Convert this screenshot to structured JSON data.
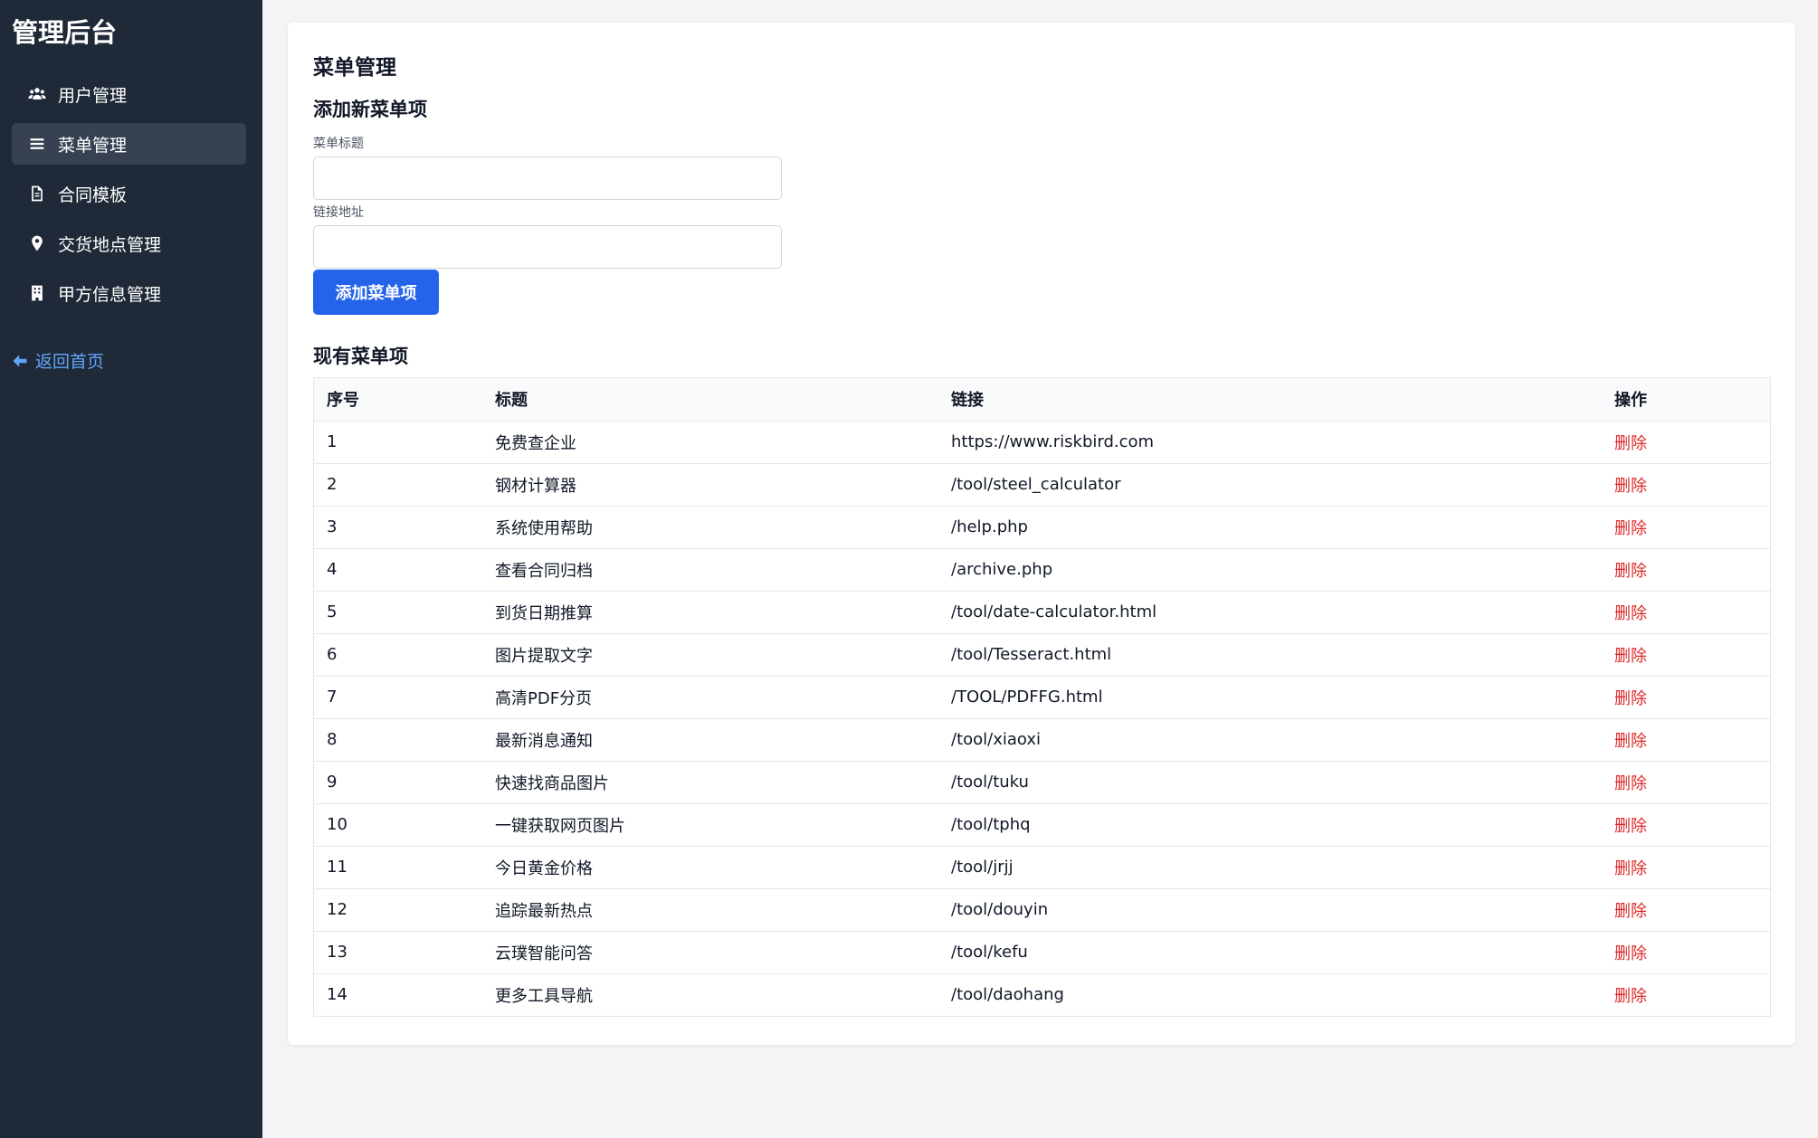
{
  "sidebar": {
    "brand": "管理后台",
    "items": [
      {
        "label": "用户管理",
        "icon": "users-icon"
      },
      {
        "label": "菜单管理",
        "icon": "bars-icon",
        "active": true
      },
      {
        "label": "合同模板",
        "icon": "file-icon"
      },
      {
        "label": "交货地点管理",
        "icon": "map-pin-icon"
      },
      {
        "label": "甲方信息管理",
        "icon": "building-icon"
      }
    ],
    "back": {
      "label": "返回首页",
      "icon": "arrow-left-icon"
    }
  },
  "main": {
    "title": "菜单管理",
    "form": {
      "heading": "添加新菜单项",
      "title_label": "菜单标题",
      "title_value": "",
      "link_label": "链接地址",
      "link_value": "",
      "submit_label": "添加菜单项"
    },
    "list": {
      "heading": "现有菜单项",
      "columns": [
        "序号",
        "标题",
        "链接",
        "操作"
      ],
      "rows": [
        {
          "id": "1",
          "title": "免费查企业",
          "link": "https://www.riskbird.com",
          "action": "删除"
        },
        {
          "id": "2",
          "title": "钢材计算器",
          "link": "/tool/steel_calculator",
          "action": "删除"
        },
        {
          "id": "3",
          "title": "系统使用帮助",
          "link": "/help.php",
          "action": "删除"
        },
        {
          "id": "4",
          "title": "查看合同归档",
          "link": "/archive.php",
          "action": "删除"
        },
        {
          "id": "5",
          "title": "到货日期推算",
          "link": "/tool/date-calculator.html",
          "action": "删除"
        },
        {
          "id": "6",
          "title": "图片提取文字",
          "link": "/tool/Tesseract.html",
          "action": "删除"
        },
        {
          "id": "7",
          "title": "高清PDF分页",
          "link": "/TOOL/PDFFG.html",
          "action": "删除"
        },
        {
          "id": "8",
          "title": "最新消息通知",
          "link": "/tool/xiaoxi",
          "action": "删除"
        },
        {
          "id": "9",
          "title": "快速找商品图片",
          "link": "/tool/tuku",
          "action": "删除"
        },
        {
          "id": "10",
          "title": "一键获取网页图片",
          "link": "/tool/tphq",
          "action": "删除"
        },
        {
          "id": "11",
          "title": "今日黄金价格",
          "link": "/tool/jrjj",
          "action": "删除"
        },
        {
          "id": "12",
          "title": "追踪最新热点",
          "link": "/tool/douyin",
          "action": "删除"
        },
        {
          "id": "13",
          "title": "云璞智能问答",
          "link": "/tool/kefu",
          "action": "删除"
        },
        {
          "id": "14",
          "title": "更多工具导航",
          "link": "/tool/daohang",
          "action": "删除"
        }
      ]
    }
  },
  "colors": {
    "sidebar_bg": "#1f2937",
    "active_bg": "#374151",
    "accent": "#2563eb",
    "link_blue": "#60a5fa",
    "danger": "#dc2626"
  }
}
